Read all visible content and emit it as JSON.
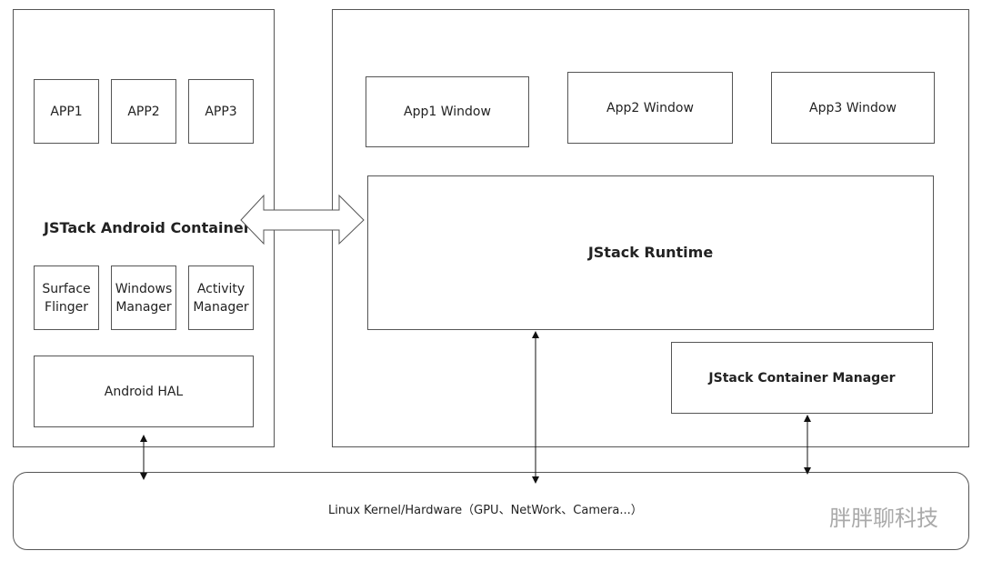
{
  "android_container": {
    "title": "JSTack Android Container",
    "apps": [
      "APP1",
      "APP2",
      "APP3"
    ],
    "services": [
      "Surface\nFlinger",
      "Windows\nManager",
      "Activity\nManager"
    ],
    "hal": "Android HAL"
  },
  "jstack": {
    "windows": [
      "App1 Window",
      "App2 Window",
      "App3 Window"
    ],
    "runtime": "JStack Runtime",
    "manager": "JStack Container Manager"
  },
  "kernel": "Linux Kernel/Hardware（GPU、NetWork、Camera...）",
  "watermark": "胖胖聊科技"
}
